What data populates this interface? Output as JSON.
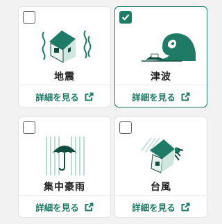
{
  "colors": {
    "accent": "#1f7a66",
    "accent_dark": "#134d40",
    "accent_light": "#cfe6de",
    "background": "#f2f2f2",
    "card": "#ffffff",
    "text": "#222222"
  },
  "cards": [
    {
      "title": "地震",
      "link_label": "詳細を見る",
      "checked": false,
      "illustration": "earthquake-house-icon"
    },
    {
      "title": "津波",
      "link_label": "詳細を見る",
      "checked": true,
      "illustration": "tsunami-wave-icon"
    },
    {
      "title": "集中豪雨",
      "link_label": "詳細を見る",
      "checked": false,
      "illustration": "umbrella-rain-icon"
    },
    {
      "title": "台風",
      "link_label": "詳細を見る",
      "checked": false,
      "illustration": "typhoon-house-icon"
    }
  ]
}
